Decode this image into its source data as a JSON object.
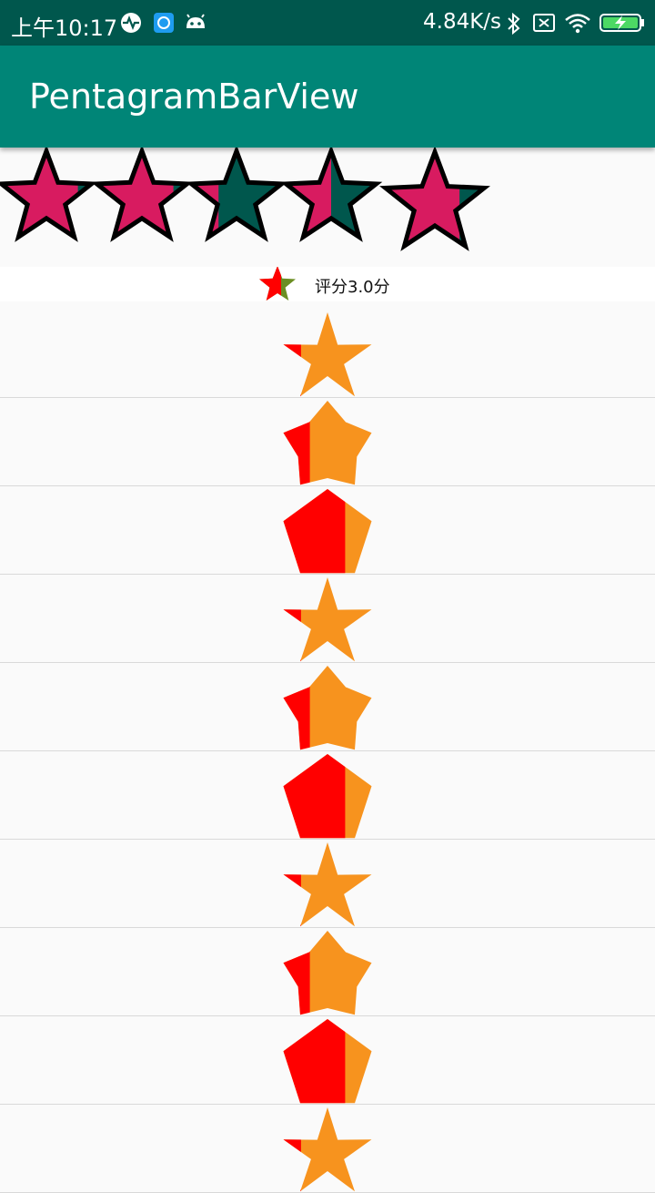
{
  "status_bar": {
    "time": "上午10:17",
    "net_speed": "4.84K/s",
    "icons": [
      "activity-icon",
      "app-icon",
      "android-icon",
      "bluetooth-icon",
      "sim-off-icon",
      "wifi-icon",
      "battery-charging-icon"
    ]
  },
  "app_bar": {
    "title": "PentagramBarView"
  },
  "top_stars": {
    "count": 5,
    "fill_fractions": [
      0.85,
      0.85,
      0.3,
      0.5,
      0.75
    ],
    "colors": {
      "filled": "#d81b60",
      "empty": "#00574d",
      "stroke": "#000000"
    }
  },
  "rating": {
    "text": "评分3.0分",
    "fill_fraction": 0.6,
    "colors": {
      "filled": "#ff0000",
      "empty": "#6b8e23"
    }
  },
  "list": {
    "colors": {
      "progress": "#ff0000",
      "base": "#f7931e"
    },
    "items": [
      {
        "shape": "star",
        "fill_fraction": 0.2
      },
      {
        "shape": "star-angular",
        "fill_fraction": 0.3
      },
      {
        "shape": "pentagon",
        "fill_fraction": 0.7
      },
      {
        "shape": "star",
        "fill_fraction": 0.2
      },
      {
        "shape": "star-angular",
        "fill_fraction": 0.3
      },
      {
        "shape": "pentagon",
        "fill_fraction": 0.7
      },
      {
        "shape": "star",
        "fill_fraction": 0.2
      },
      {
        "shape": "star-angular",
        "fill_fraction": 0.3
      },
      {
        "shape": "pentagon",
        "fill_fraction": 0.7
      },
      {
        "shape": "star",
        "fill_fraction": 0.2
      }
    ]
  }
}
